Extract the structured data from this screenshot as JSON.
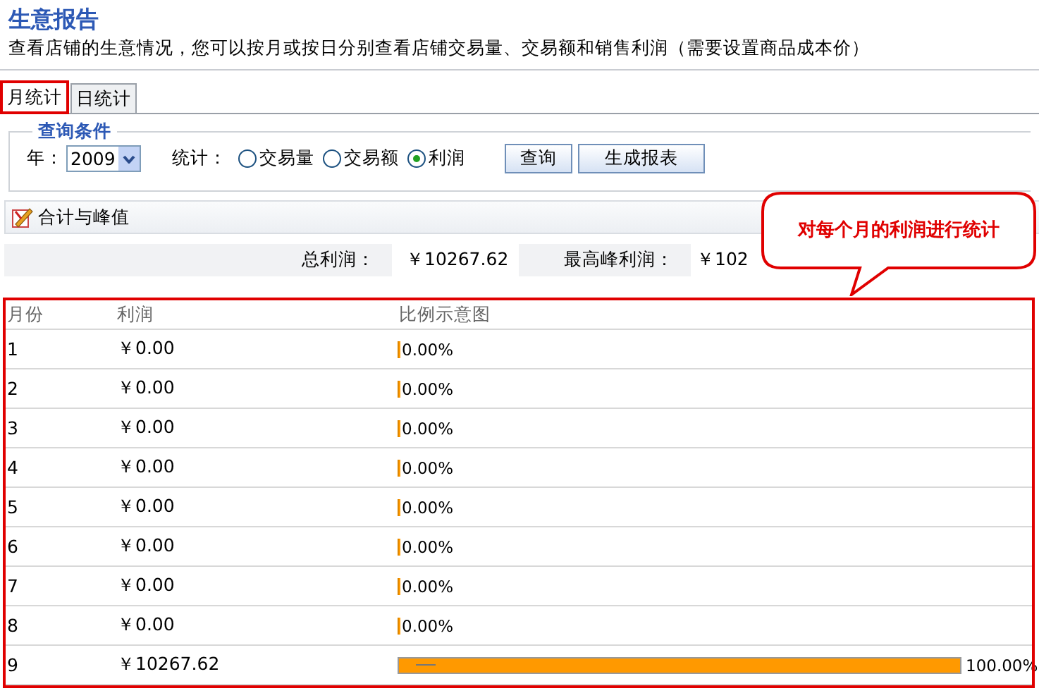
{
  "header": {
    "title": "生意报告",
    "description": "查看店铺的生意情况，您可以按月或按日分别查看店铺交易量、交易额和销售利润（需要设置商品成本价）"
  },
  "tabs": [
    {
      "label": "月统计",
      "selected": true,
      "highlighted": true
    },
    {
      "label": "日统计",
      "selected": false,
      "highlighted": false
    }
  ],
  "query": {
    "legend": "查询条件",
    "year_label": "年：",
    "year": "2009",
    "stat_label": "统计：",
    "options": [
      {
        "label": "交易量",
        "selected": false
      },
      {
        "label": "交易额",
        "selected": false
      },
      {
        "label": "利润",
        "selected": true
      }
    ],
    "buttons": [
      "查询",
      "生成报表"
    ]
  },
  "section": {
    "title": "合计与峰值"
  },
  "summary": [
    {
      "label": "总利润：",
      "value": "￥10267.62"
    },
    {
      "label": "最高峰利润：",
      "value": "￥102"
    }
  ],
  "callout": {
    "text": "对每个月的利润进行统计"
  },
  "table": {
    "highlighted": true,
    "columns": [
      "月份",
      "利润",
      "比例示意图"
    ],
    "rows": [
      {
        "month": "1",
        "profit": "￥0.00",
        "level": 0,
        "percent": "0.00%"
      },
      {
        "month": "2",
        "profit": "￥0.00",
        "level": 0,
        "percent": "0.00%"
      },
      {
        "month": "3",
        "profit": "￥0.00",
        "level": 0,
        "percent": "0.00%"
      },
      {
        "month": "4",
        "profit": "￥0.00",
        "level": 0,
        "percent": "0.00%"
      },
      {
        "month": "5",
        "profit": "￥0.00",
        "level": 0,
        "percent": "0.00%"
      },
      {
        "month": "6",
        "profit": "￥0.00",
        "level": 0,
        "percent": "0.00%"
      },
      {
        "month": "7",
        "profit": "￥0.00",
        "level": 0,
        "percent": "0.00%"
      },
      {
        "month": "8",
        "profit": "￥0.00",
        "level": 0,
        "percent": "0.00%"
      },
      {
        "month": "9",
        "profit": "￥10267.62",
        "level": 1,
        "percent": "100.00%"
      }
    ]
  }
}
